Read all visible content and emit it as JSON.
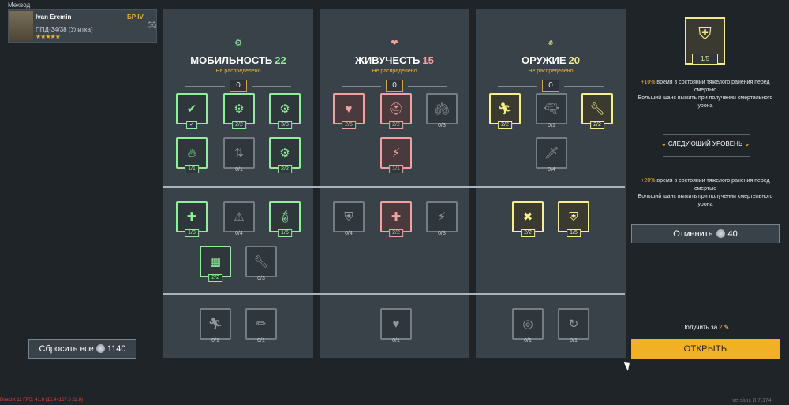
{
  "top_label": "Мехвод",
  "crew": {
    "name": "Ivan Eremin",
    "rank": "БР IV",
    "vehicle": "ППД-34/38 (Улитка)",
    "stars": "★★★★★"
  },
  "panels": [
    {
      "title": "МОБИЛЬНОСТЬ",
      "points": "22",
      "subtitle": "Не распределено",
      "unallocated": "0",
      "skills": [
        {
          "name": "mobility-skill-1",
          "icon": "✔",
          "count": "✔",
          "style": "g",
          "label_icon": "driver-seat-icon"
        },
        {
          "name": "mobility-skill-2",
          "icon": "⚙",
          "count": "2/2",
          "style": "g",
          "label_icon": "backpack-icon"
        },
        {
          "name": "mobility-skill-3",
          "icon": "⚙",
          "count": "3/3",
          "style": "g",
          "label_icon": "engine-icon"
        },
        {
          "name": "mobility-skill-4",
          "icon": "🔥",
          "count": "1/1",
          "style": "g",
          "label_icon": "fire-icon"
        },
        {
          "name": "mobility-skill-5",
          "icon": "⇅",
          "count": "0/1",
          "style": "n",
          "label_icon": "seat-adjust-icon"
        },
        {
          "name": "mobility-skill-6",
          "icon": "⚙",
          "count": "2/2",
          "style": "g",
          "label_icon": "boot-icon"
        },
        {
          "name": "mobility-skill-7",
          "icon": "✚",
          "count": "1/3",
          "style": "g",
          "label_icon": "first-aid-icon"
        },
        {
          "name": "mobility-skill-8",
          "icon": "⚠",
          "count": "0/4",
          "style": "n",
          "label_icon": "climb-icon"
        },
        {
          "name": "mobility-skill-9",
          "icon": "🧯",
          "count": "1/5",
          "style": "g",
          "label_icon": "extinguisher-icon"
        },
        {
          "name": "mobility-skill-10",
          "icon": "▦",
          "count": "2/2",
          "style": "g",
          "label_icon": "gearbox-icon"
        },
        {
          "name": "mobility-skill-11",
          "icon": "🔧",
          "count": "0/3",
          "style": "n",
          "label_icon": "wrench-icon"
        },
        {
          "name": "mobility-skill-12",
          "icon": "🏃",
          "count": "0/1",
          "style": "n",
          "label_icon": "sprint-icon"
        },
        {
          "name": "mobility-skill-13",
          "icon": "✏",
          "count": "0/1",
          "style": "n",
          "label_icon": "pen-arrow-icon"
        }
      ]
    },
    {
      "title": "ЖИВУЧЕСТЬ",
      "points": "15",
      "subtitle": "Не распределено",
      "unallocated": "0",
      "skills": [
        {
          "name": "survival-skill-1",
          "icon": "♥",
          "count": "2/5",
          "style": "r",
          "label_icon": "heart-cycle-icon"
        },
        {
          "name": "survival-skill-2",
          "icon": "⛑",
          "count": "2/2",
          "style": "r",
          "label_icon": "helmet-icon"
        },
        {
          "name": "survival-skill-3",
          "icon": "🫁",
          "count": "0/3",
          "style": "n",
          "label_icon": "lungs-icon"
        },
        {
          "name": "survival-skill-4",
          "icon": "⚡",
          "count": "1/1",
          "style": "r",
          "label_icon": "energy-cycle-icon"
        },
        {
          "name": "survival-skill-5",
          "icon": "⛨",
          "count": "0/4",
          "style": "n",
          "label_icon": "shield-icon"
        },
        {
          "name": "survival-skill-6",
          "icon": "✚",
          "count": "2/2",
          "style": "r",
          "label_icon": "health-up-icon"
        },
        {
          "name": "survival-skill-7",
          "icon": "⚡",
          "count": "0/3",
          "style": "n",
          "label_icon": "lightning-up-icon"
        },
        {
          "name": "survival-skill-8",
          "icon": "♥",
          "count": "0/1",
          "style": "n",
          "label_icon": "heart-up-icon"
        }
      ]
    },
    {
      "title": "ОРУЖИЕ",
      "points": "20",
      "subtitle": "Не распределено",
      "unallocated": "0",
      "skills": [
        {
          "name": "weapon-skill-1",
          "icon": "🏃",
          "count": "2/2",
          "style": "y",
          "label_icon": "soldier-dodge-icon"
        },
        {
          "name": "weapon-skill-2",
          "icon": "🔫",
          "count": "0/1",
          "style": "n",
          "label_icon": "pistol-icon"
        },
        {
          "name": "weapon-skill-3",
          "icon": "🔧",
          "count": "2/2",
          "style": "y",
          "label_icon": "wrench-plus-icon"
        },
        {
          "name": "weapon-skill-4",
          "icon": "🗡",
          "count": "0/4",
          "style": "n",
          "label_icon": "knife-icon"
        },
        {
          "name": "weapon-skill-5",
          "icon": "✖",
          "count": "2/2",
          "style": "y",
          "label_icon": "crossed-tools-icon"
        },
        {
          "name": "weapon-skill-6",
          "icon": "⛨",
          "count": "1/5",
          "style": "y",
          "label_icon": "badge-plus-icon"
        },
        {
          "name": "weapon-skill-7",
          "icon": "◎",
          "count": "0/1",
          "style": "n",
          "label_icon": "target-icon"
        },
        {
          "name": "weapon-skill-8",
          "icon": "↻",
          "count": "0/1",
          "style": "n",
          "label_icon": "reload-icon"
        }
      ]
    }
  ],
  "reset_button": {
    "label": "Сбросить все",
    "cost": "1140"
  },
  "detail": {
    "badge_icon": "badge-plus-icon",
    "badge_count": "1/5",
    "current_pct": "+10%",
    "current_text_1": "время в состоянии тяжелого ранения перед смертью",
    "current_text_2": "Больший шанс выжить при получении смертельного урона",
    "next_level_label": "СЛЕДУЮЩИЙ УРОВЕНЬ",
    "next_pct": "+20%",
    "next_text_1": "время в состоянии тяжелого ранения перед смертью",
    "next_text_2": "Больший шанс выжить при получении смертельного урона",
    "cancel_label": "Отменить",
    "cancel_cost": "40",
    "receive_label": "Получить за",
    "receive_cost": "2",
    "open_label": "ОТКРЫТЬ"
  },
  "debug_text": "DirectX 11 FPS: 41.8 (15.4<167.6 22.8)",
  "version": "version: 0.7.174"
}
